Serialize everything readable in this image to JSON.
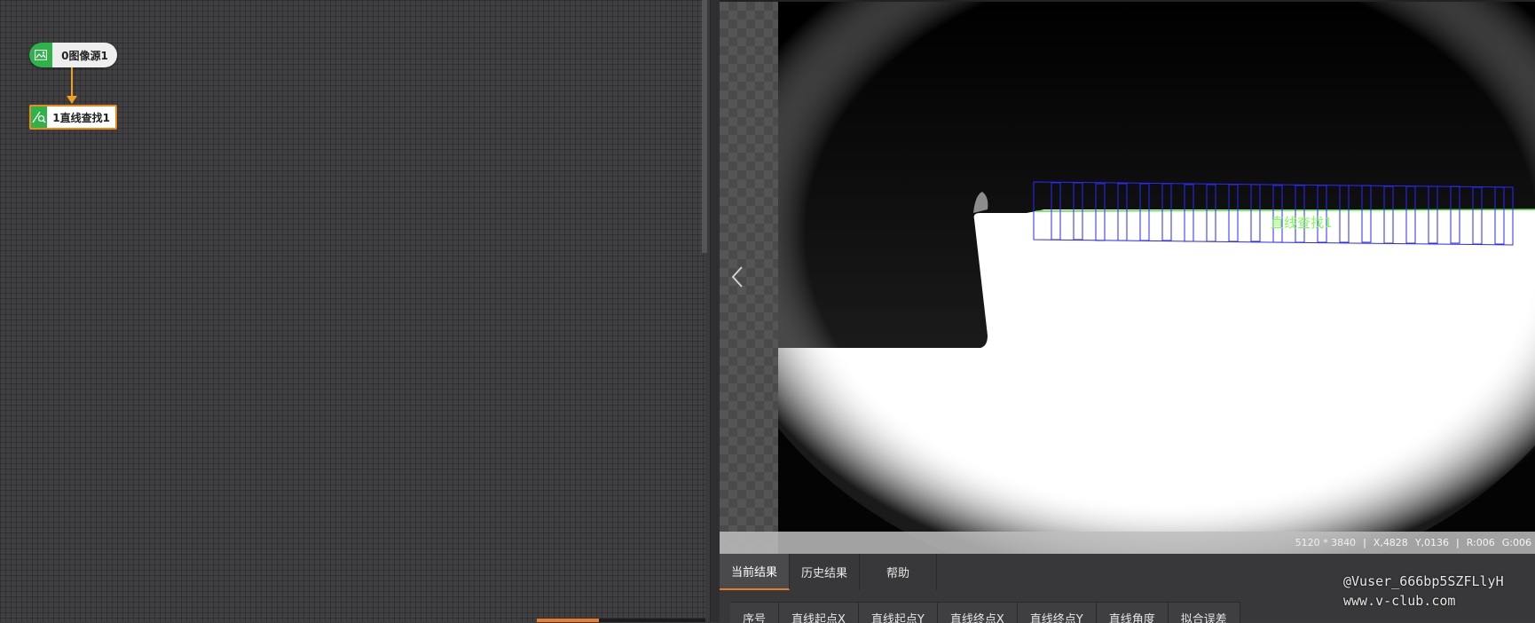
{
  "flow": {
    "nodes": [
      {
        "label": "0图像源1",
        "icon": "image-icon"
      },
      {
        "label": "1直线查找1",
        "icon": "line-find-icon"
      }
    ]
  },
  "viewer": {
    "overlay_label": "直线查找1",
    "status": {
      "resolution": "5120 * 3840",
      "x": "X,4828",
      "y": "Y,0136",
      "r": "R:006",
      "g": "G:006"
    }
  },
  "result_panel": {
    "tabs": [
      "当前结果",
      "历史结果",
      "帮助"
    ],
    "active_tab": "当前结果",
    "columns": [
      "序号",
      "直线起点X",
      "直线起点Y",
      "直线终点X",
      "直线终点Y",
      "直线角度",
      "拟合误差"
    ]
  },
  "watermark": {
    "line1": "@Vuser_666bp5SZFLlyH",
    "line2": "www.v-club.com"
  },
  "colors": {
    "node_green": "#2db34a",
    "selection_orange": "#e98a1c",
    "roi_blue": "#2a2aff",
    "overlay_green": "#7cff4a"
  }
}
